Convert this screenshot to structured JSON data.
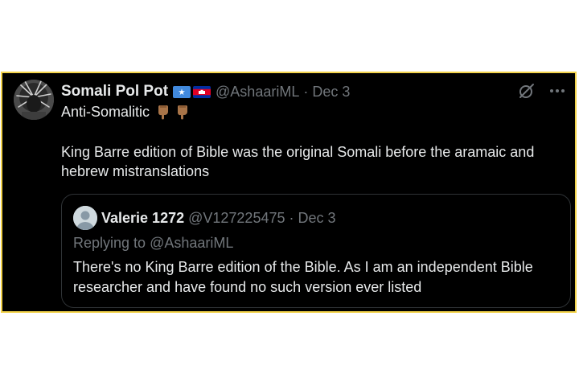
{
  "tweet": {
    "display_name": "Somali Pol Pot",
    "handle": "@AshaariML",
    "separator": "·",
    "date": "Dec 3",
    "line1": "Anti-Somalitic",
    "emojis": [
      "point-down-emoji",
      "point-down-emoji"
    ],
    "body": "King Barre edition of Bible was the original Somali before the aramaic and hebrew mistranslations",
    "flags": [
      "somalia-flag",
      "cambodia-flag"
    ]
  },
  "quote": {
    "display_name": "Valerie 1272",
    "handle": "@V127225475",
    "separator": "·",
    "date": "Dec 3",
    "replying_prefix": "Replying to ",
    "replying_handle": "@AshaariML",
    "text": "There's no King Barre edition of the Bible. As I am an independent Bible researcher and have found no such version ever listed"
  },
  "colors": {
    "background": "#000000",
    "frame_border": "#f3d34a",
    "text_primary": "#e7e9ea",
    "text_secondary": "#71767b",
    "card_border": "#2f3336"
  },
  "icons": [
    "grok-icon",
    "more-options-icon"
  ]
}
